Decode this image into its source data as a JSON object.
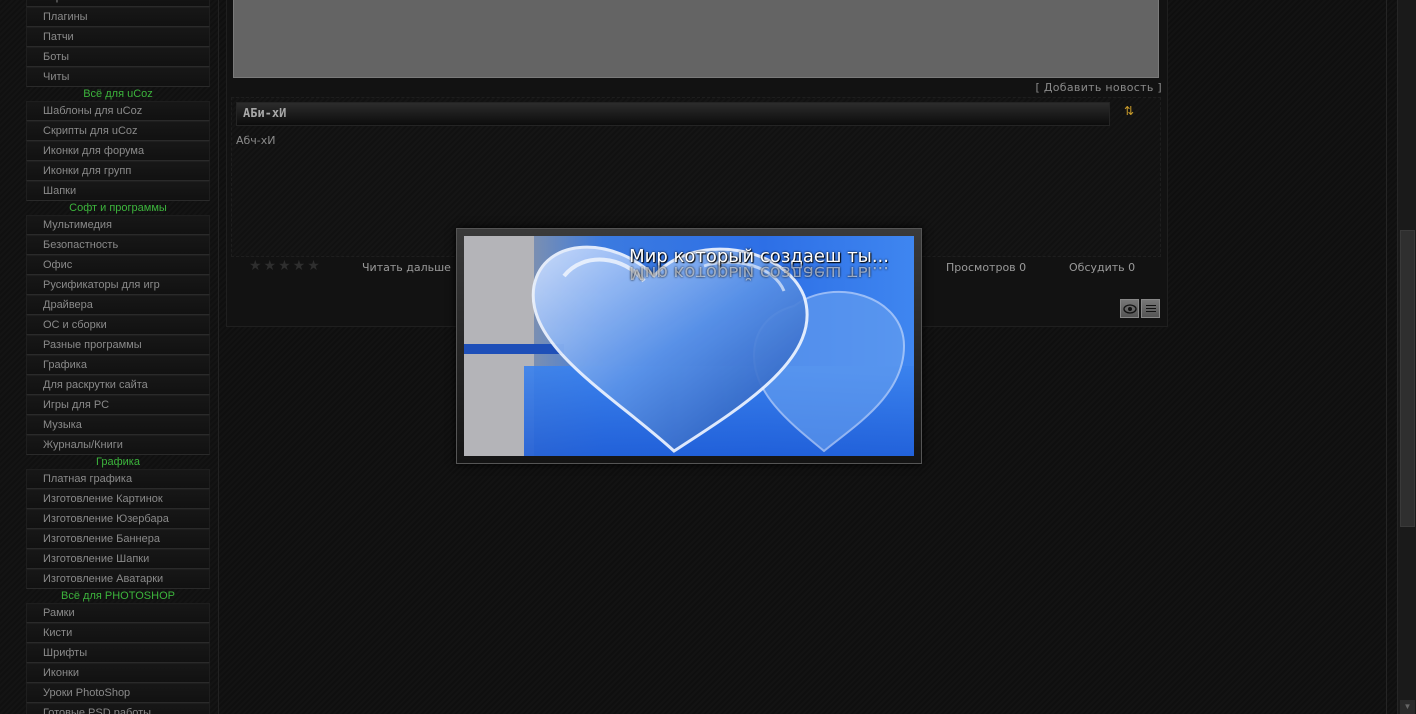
{
  "sidebar": {
    "sections": [
      {
        "type": "item",
        "label": "Скрипты"
      },
      {
        "type": "item",
        "label": "Плагины"
      },
      {
        "type": "item",
        "label": "Патчи"
      },
      {
        "type": "item",
        "label": "Боты"
      },
      {
        "type": "item",
        "label": "Читы"
      },
      {
        "type": "category",
        "label": "Всё для uCoz"
      },
      {
        "type": "item",
        "label": "Шаблоны для uCoz"
      },
      {
        "type": "item",
        "label": "Скрипты для uCoz"
      },
      {
        "type": "item",
        "label": "Иконки для форума"
      },
      {
        "type": "item",
        "label": "Иконки для групп"
      },
      {
        "type": "item",
        "label": "Шапки"
      },
      {
        "type": "category",
        "label": "Софт и программы"
      },
      {
        "type": "item",
        "label": "Мультимедия"
      },
      {
        "type": "item",
        "label": "Безопастность"
      },
      {
        "type": "item",
        "label": "Офис"
      },
      {
        "type": "item",
        "label": "Русификаторы для игр"
      },
      {
        "type": "item",
        "label": "Драйвера"
      },
      {
        "type": "item",
        "label": "ОС и сборки"
      },
      {
        "type": "item",
        "label": "Разные программы"
      },
      {
        "type": "item",
        "label": "Графика"
      },
      {
        "type": "item",
        "label": "Для раскрутки сайта"
      },
      {
        "type": "item",
        "label": "Игры для PC"
      },
      {
        "type": "item",
        "label": "Музыка"
      },
      {
        "type": "item",
        "label": "Журналы/Книги"
      },
      {
        "type": "category",
        "label": "Графика"
      },
      {
        "type": "item",
        "label": "Платная графика"
      },
      {
        "type": "item",
        "label": "Изготовление Картинок"
      },
      {
        "type": "item",
        "label": "Изготовление Юзербара"
      },
      {
        "type": "item",
        "label": "Изготовление Баннера"
      },
      {
        "type": "item",
        "label": "Изготовление Шапки"
      },
      {
        "type": "item",
        "label": "Изготовление Аватарки"
      },
      {
        "type": "category",
        "label": "Всё для PHOTOSHOP"
      },
      {
        "type": "item",
        "label": "Рамки"
      },
      {
        "type": "item",
        "label": "Кисти"
      },
      {
        "type": "item",
        "label": "Шрифты"
      },
      {
        "type": "item",
        "label": "Иконки"
      },
      {
        "type": "item",
        "label": "Уроки PhotoShop"
      },
      {
        "type": "item",
        "label": "Готовые PSD работы"
      }
    ]
  },
  "content": {
    "add_news": "[ Добавить новость ]",
    "post": {
      "title": "АБи-хИ",
      "body": "Абч-хИ",
      "arrows": "⇅",
      "stars": "★★★★★",
      "read_more": "Читать дальше",
      "views": "Просмотров 0",
      "discuss": "Обсудить 0"
    }
  },
  "popup": {
    "caption": "Мир который создаеш ты..."
  },
  "colors": {
    "category_green": "#3cb43c",
    "accent_orange": "#c79a2a",
    "popup_blue": "#2d6fe6"
  }
}
